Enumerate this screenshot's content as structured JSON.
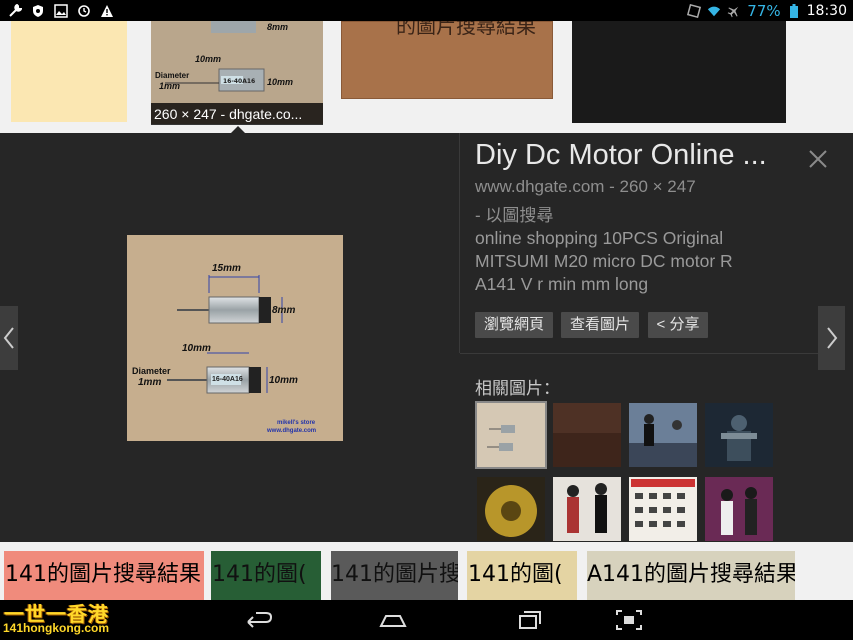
{
  "status_bar": {
    "left_icons": [
      "wrench-icon",
      "shield-icon",
      "image-icon",
      "sync-icon",
      "warning-icon"
    ],
    "right_icons": [
      "screenshot-icon",
      "wifi-icon",
      "airplane-icon",
      "battery-icon"
    ],
    "battery_percent": "77%",
    "time": "18:30"
  },
  "top_results": {
    "selected_caption": "260 × 247 - dhgate.co...",
    "selected_labels": [
      "8mm",
      "10mm",
      "Diameter",
      "1mm",
      "10mm"
    ],
    "overlap_text": "的圖片搜尋結果"
  },
  "detail": {
    "title": "Diy Dc Motor Online ...",
    "site": "www.dhgate.com - 260 × 247",
    "search_by_image": " - 以圖搜尋",
    "description": "online shopping 10PCS Original MITSUMI M20 micro DC motor R A141 V r min mm long",
    "buttons": {
      "visit_page": "瀏覽網頁",
      "view_image": "查看圖片",
      "share": "< 分享"
    },
    "related_label": "相關圖片：",
    "preview_labels": {
      "top_dim": "15mm",
      "right_dim_1": "8mm",
      "mid_dim": "10mm",
      "diameter": "Diameter",
      "diameter_val": "1mm",
      "right_dim_2": "10mm",
      "motor_marking": "16-40A16",
      "watermark_1": "mikell's store",
      "watermark_2": "www.dhgate.com"
    }
  },
  "bottom_results": [
    "141的圖片搜尋結果",
    "141的圖(",
    "141的圖片搜",
    "141的圖(",
    "A141的圖片搜尋結果"
  ],
  "logo": {
    "main": "一世一香港",
    "sub": "141hongkong.com"
  },
  "colors": {
    "battery_blue": "#35b5e5",
    "panel_bg": "#262626",
    "logo_yellow": "#ffd82a"
  }
}
